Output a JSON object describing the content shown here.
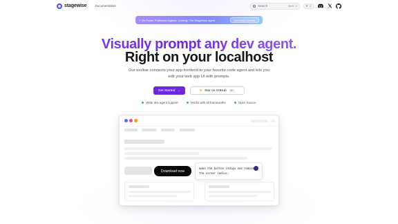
{
  "nav": {
    "brand": "stagewise",
    "link_docs": "Documentation",
    "search_placeholder": "Search",
    "search_shortcut_key": "Ctrl K",
    "search_shortcut_x": "X"
  },
  "banner": {
    "text": "⚡ On Power Pullbacks! Agents: Coming: The Stagewise agent.",
    "button": "Get Early Access"
  },
  "hero": {
    "title_line1": "Visually prompt any dev agent.",
    "title_line2": "Right on your localhost",
    "subtitle_line1": "Our toolbar connects your app frontend to your favorite code agent and lets you",
    "subtitle_line2": "edit your web app UI with prompts.",
    "cta_primary": "Get Started",
    "cta_primary_arrow": "→",
    "cta_secondary": "Star on GitHub",
    "cta_secondary_count": "3k+"
  },
  "features": [
    "Wide dev agent support",
    "Works with all frameworks",
    "Open Source"
  ],
  "mock": {
    "download_button": "Download now",
    "prompt_text": "make the button indigo and remove the corner radius;"
  },
  "colors": {
    "accent": "#6d28d9",
    "feature_dot": "#22c55e",
    "traffic_blue": "#6366f1",
    "traffic_pink": "#ec4899",
    "traffic_yellow": "#f59e0b"
  }
}
